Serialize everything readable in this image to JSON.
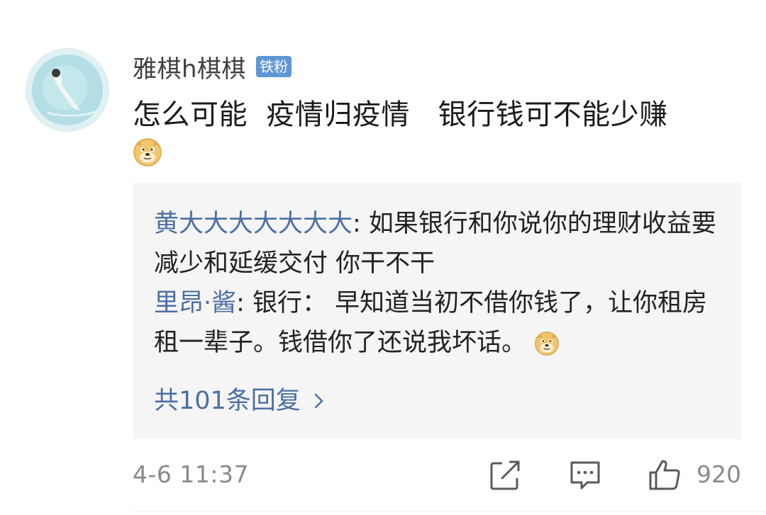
{
  "comment": {
    "username": "雅棋h棋棋",
    "badge": "铁粉",
    "text": "怎么可能  疫情归疫情   银行钱可不能少赚",
    "emoji": "doge-icon"
  },
  "replies": [
    {
      "name": "黄大大大大大大大",
      "text": ": 如果银行和你说你的理财收益要减少和延缓交付 你干不干"
    },
    {
      "name": "里昂·酱",
      "text": ": 银行：  早知道当初不借你钱了，让你租房租一辈子。钱借你了还说我坏话。",
      "emoji": "doge-icon"
    }
  ],
  "more_replies": "共101条回复",
  "footer": {
    "time": "4-6 11:37",
    "like_count": "920"
  },
  "colors": {
    "link": "#4b6fa3",
    "badge": "#5f96d6",
    "reply_bg": "#f5f5f5"
  }
}
